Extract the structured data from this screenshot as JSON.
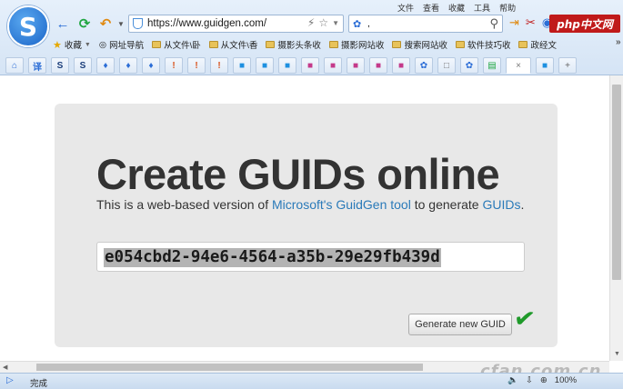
{
  "menu": {
    "left": [
      "文件",
      "查看",
      "收藏",
      "工具",
      "帮助"
    ],
    "right": [
      "»"
    ]
  },
  "brand": "php中文网",
  "address": {
    "url": "https://www.guidgen.com/"
  },
  "search": {
    "value": ","
  },
  "bookmarks": {
    "favorites_label": "收藏",
    "items": [
      "网址导航",
      "从文件\\卧",
      "从文件\\香",
      "摄影头条收",
      "摄影网站收",
      "搜索网站收",
      "软件技巧收",
      "政经文"
    ]
  },
  "tabs": [
    "⌂",
    "译",
    "S",
    "S",
    "♦",
    "♦",
    "♦",
    "!",
    "!",
    "!",
    "■",
    "■",
    "■",
    "■",
    "■",
    "■",
    "■",
    "■",
    "✿",
    "□",
    "✿",
    "▤",
    "×",
    "■",
    "+"
  ],
  "page": {
    "title": "Create GUIDs online",
    "lead_prefix": "This is a web-based version of ",
    "lead_link1": "Microsoft's GuidGen tool",
    "lead_middle": " to generate ",
    "lead_link2": "GUIDs",
    "lead_suffix": ".",
    "guid": "e054cbd2-94e6-4564-a35b-29e29fb439d",
    "generate_label": "Generate new GUID"
  },
  "status": {
    "text": "完成",
    "zoom": "100%"
  },
  "watermark": "cfan.com.cn",
  "colors": {
    "link": "#2a7ab9",
    "checkmark": "#1f9a2a",
    "brand": "#c01a1a"
  }
}
